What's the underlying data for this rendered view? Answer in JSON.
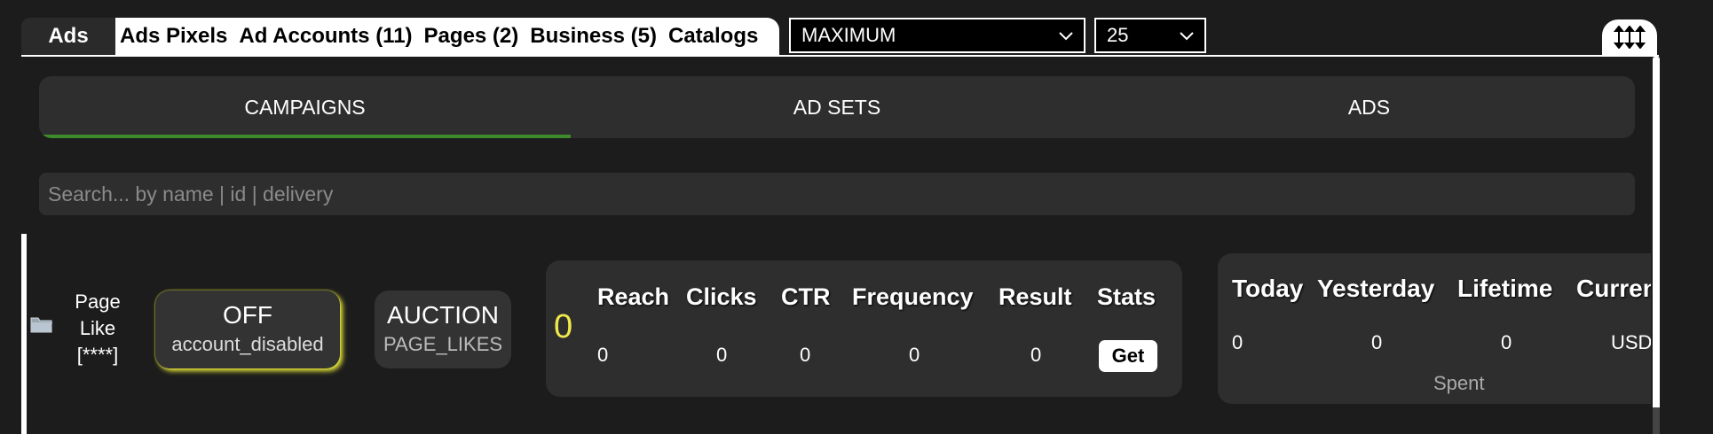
{
  "top_tabs": {
    "ads": "Ads",
    "ads_pixels": "Ads Pixels",
    "ad_accounts": "Ad Accounts (11)",
    "pages": "Pages (2)",
    "business": "Business (5)",
    "catalogs": "Catalogs"
  },
  "selects": {
    "mode": "MAXIMUM",
    "limit": "25"
  },
  "icons": {
    "toggle": "expand-vertical-icon",
    "folder": "folder-icon",
    "chevron": "chevron-down-icon"
  },
  "sub_tabs": {
    "campaigns": "CAMPAIGNS",
    "ad_sets": "AD SETS",
    "ads": "ADS",
    "active": "CAMPAIGNS"
  },
  "search": {
    "placeholder": "Search... by name | id | delivery"
  },
  "campaign": {
    "name_line1": "Page",
    "name_line2": "Like",
    "name_line3": "[****]",
    "status": "OFF",
    "status_reason": "account_disabled",
    "bid": "AUCTION",
    "objective": "PAGE_LIKES",
    "count": "0"
  },
  "stats": {
    "headers": {
      "reach": "Reach",
      "clicks": "Clicks",
      "ctr": "CTR",
      "frequency": "Frequency",
      "result": "Result",
      "stats": "Stats"
    },
    "values": {
      "reach": "0",
      "clicks": "0",
      "ctr": "0",
      "frequency": "0",
      "result": "0"
    },
    "get_label": "Get"
  },
  "spend": {
    "headers": {
      "today": "Today",
      "yesterday": "Yesterday",
      "lifetime": "Lifetime",
      "currency": "Curren"
    },
    "values": {
      "today": "0",
      "yesterday": "0",
      "lifetime": "0",
      "currency": "USD"
    },
    "label": "Spent"
  },
  "colors": {
    "background": "#1c1c1c",
    "card": "#2e2e2e",
    "active_tab_indicator": "#3d8b2b",
    "status_glow": "#e8e83a",
    "count": "#f0e94a"
  }
}
